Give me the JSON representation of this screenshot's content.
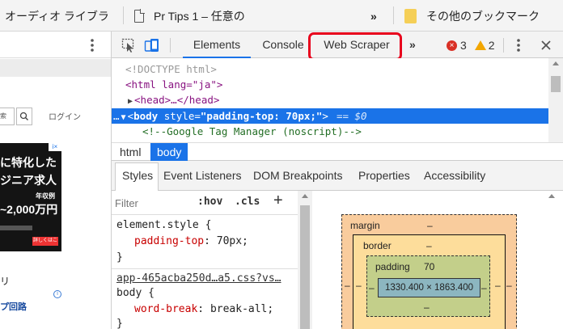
{
  "bookmarks": {
    "items": [
      "オーディオ ライブラ",
      "Pr Tips 1 – 任意の"
    ],
    "more": "»",
    "other": "その他のブックマーク"
  },
  "page": {
    "login": "ログイン",
    "ad_lines": [
      "に特化した",
      "ジニア求人",
      "年収例",
      "~2,000万円",
      "詳しくはこちら"
    ],
    "ad_badge": "i×",
    "snippet_a": "リ",
    "snippet_b": "プ回路"
  },
  "devtools": {
    "tabs": [
      "Elements",
      "Console",
      "Web Scraper"
    ],
    "more_tabs": "»",
    "error_count": "3",
    "warning_count": "2",
    "tree": {
      "doctype": "<!DOCTYPE html>",
      "html_open": "<html lang=\"ja\">",
      "head": "<head>…</head>",
      "body_tag": "body",
      "body_attr": "style",
      "body_val": "\"padding-top: 70px;\"",
      "body_eq": "== $0",
      "gtm_comment": "<!--Google Tag Manager (noscript)-->"
    },
    "breadcrumbs": [
      "html",
      "body"
    ],
    "sidebar_tabs": [
      "Styles",
      "Event Listeners",
      "DOM Breakpoints",
      "Properties",
      "Accessibility"
    ],
    "styles": {
      "filter_placeholder": "Filter",
      "hov": ":hov",
      "cls": ".cls",
      "add": "+",
      "element_style_selector": "element.style {",
      "rule1_prop": "padding-top",
      "rule1_val": "70px;",
      "close_brace": "}",
      "source_link": "app-465acba250d…a5.css?vs…",
      "body_selector": "body {",
      "rule2_prop": "word-break",
      "rule2_val": "break-all;"
    },
    "box_model": {
      "margin_label": "margin",
      "border_label": "border",
      "padding_label": "padding",
      "padding_value": "70",
      "content_size": "1330.400 × 1863.400",
      "dash": "–"
    }
  }
}
